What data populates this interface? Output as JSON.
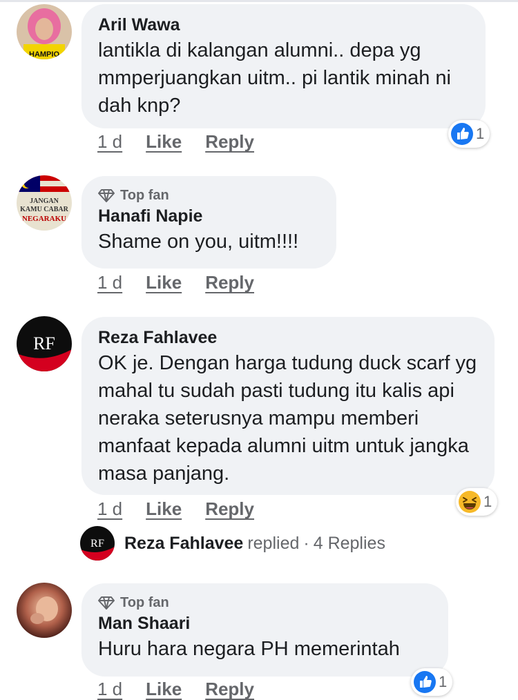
{
  "comments": [
    {
      "author": "Aril Wawa",
      "top_fan": false,
      "text": "lantikla di kalangan alumni.. depa yg mmperjuangkan uitm.. pi lantik minah ni dah knp?",
      "time": "1 d",
      "like": "Like",
      "reply": "Reply",
      "reaction": {
        "type": "like",
        "count": "1"
      },
      "avatar_text": "HAMPIO"
    },
    {
      "author": "Hanafi Napie",
      "top_fan": true,
      "top_fan_label": "Top fan",
      "text": "Shame on you, uitm!!!!",
      "time": "1 d",
      "like": "Like",
      "reply": "Reply",
      "avatar_text": [
        "JANGAN",
        "KAMU CABAR",
        "NEGARAKU"
      ]
    },
    {
      "author": "Reza Fahlavee",
      "top_fan": false,
      "text": "OK je. Dengan harga tudung duck scarf yg mahal tu sudah pasti tudung itu kalis api neraka seterusnya mampu memberi manfaat kepada alumni uitm untuk jangka masa panjang.",
      "time": "1 d",
      "like": "Like",
      "reply": "Reply",
      "reaction": {
        "type": "haha",
        "count": "1"
      },
      "replies": {
        "name": "Reza Fahlavee",
        "action": "replied",
        "separator": "·",
        "count_label": "4 Replies"
      }
    },
    {
      "author": "Man Shaari",
      "top_fan": true,
      "top_fan_label": "Top fan",
      "text": "Huru hara negara PH memerintah",
      "time": "1 d",
      "like": "Like",
      "reply": "Reply",
      "reaction": {
        "type": "like",
        "count": "1"
      }
    }
  ],
  "colors": {
    "bubble": "#f0f2f5",
    "meta": "#65676b",
    "like_blue": "#1877f2",
    "haha_yellow": "#f7b928"
  }
}
